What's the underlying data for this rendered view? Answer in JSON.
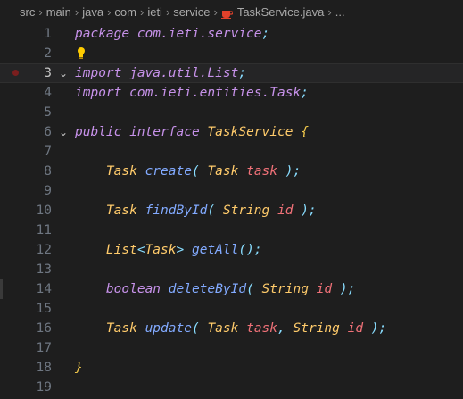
{
  "breadcrumb": {
    "items": [
      "src",
      "main",
      "java",
      "com",
      "ieti",
      "service",
      "TaskService.java",
      "..."
    ]
  },
  "editor": {
    "current_line": 3,
    "lines": [
      {
        "n": "1",
        "tokens": [
          [
            "package ",
            "k"
          ],
          [
            "com.ieti.service",
            "p"
          ],
          [
            ";",
            "pu"
          ]
        ]
      },
      {
        "n": "2",
        "tokens": []
      },
      {
        "n": "3",
        "tokens": [
          [
            "import ",
            "k"
          ],
          [
            "java.util.List",
            "p"
          ],
          [
            ";",
            "pu"
          ]
        ]
      },
      {
        "n": "4",
        "tokens": [
          [
            "import ",
            "k"
          ],
          [
            "com.ieti.entities.Task",
            "p"
          ],
          [
            ";",
            "pu"
          ]
        ]
      },
      {
        "n": "5",
        "tokens": []
      },
      {
        "n": "6",
        "tokens": [
          [
            "public ",
            "k"
          ],
          [
            "interface ",
            "k"
          ],
          [
            "TaskService ",
            "t"
          ],
          [
            "{",
            "br"
          ]
        ]
      },
      {
        "n": "7",
        "tokens": []
      },
      {
        "n": "8",
        "tokens": [
          [
            "    ",
            " "
          ],
          [
            "Task ",
            "t"
          ],
          [
            "create",
            "m"
          ],
          [
            "( ",
            "pu"
          ],
          [
            "Task ",
            "t"
          ],
          [
            "task ",
            "v"
          ],
          [
            ");",
            "pu"
          ]
        ]
      },
      {
        "n": "9",
        "tokens": []
      },
      {
        "n": "10",
        "tokens": [
          [
            "    ",
            " "
          ],
          [
            "Task ",
            "t"
          ],
          [
            "findById",
            "m"
          ],
          [
            "( ",
            "pu"
          ],
          [
            "String ",
            "t"
          ],
          [
            "id ",
            "v"
          ],
          [
            ");",
            "pu"
          ]
        ]
      },
      {
        "n": "11",
        "tokens": []
      },
      {
        "n": "12",
        "tokens": [
          [
            "    ",
            " "
          ],
          [
            "List",
            "t"
          ],
          [
            "<",
            "pu"
          ],
          [
            "Task",
            "t"
          ],
          [
            "> ",
            "pu"
          ],
          [
            "getAll",
            "m"
          ],
          [
            "();",
            "pu"
          ]
        ]
      },
      {
        "n": "13",
        "tokens": []
      },
      {
        "n": "14",
        "tokens": [
          [
            "    ",
            " "
          ],
          [
            "boolean ",
            "k"
          ],
          [
            "deleteById",
            "m"
          ],
          [
            "( ",
            "pu"
          ],
          [
            "String ",
            "t"
          ],
          [
            "id ",
            "v"
          ],
          [
            ");",
            "pu"
          ]
        ]
      },
      {
        "n": "15",
        "tokens": []
      },
      {
        "n": "16",
        "tokens": [
          [
            "    ",
            " "
          ],
          [
            "Task ",
            "t"
          ],
          [
            "update",
            "m"
          ],
          [
            "( ",
            "pu"
          ],
          [
            "Task ",
            "t"
          ],
          [
            "task",
            "v"
          ],
          [
            ", ",
            "pu"
          ],
          [
            "String ",
            "t"
          ],
          [
            "id ",
            "v"
          ],
          [
            ");",
            "pu"
          ]
        ]
      },
      {
        "n": "17",
        "tokens": []
      },
      {
        "n": "18",
        "tokens": [
          [
            "}",
            "br"
          ]
        ]
      },
      {
        "n": "19",
        "tokens": []
      }
    ]
  },
  "icons": {
    "file": "java-coffee-icon",
    "hint": "lightbulb-icon",
    "fold": "chevron-down-icon",
    "breakpoint": "breakpoint-dot-icon"
  },
  "colors": {
    "background": "#1e1e1e",
    "keyword": "#c792ea",
    "type": "#ffcb6b",
    "method": "#82aaff",
    "param": "#f07178",
    "punct": "#89ddff",
    "java_icon": "#e0412b"
  }
}
